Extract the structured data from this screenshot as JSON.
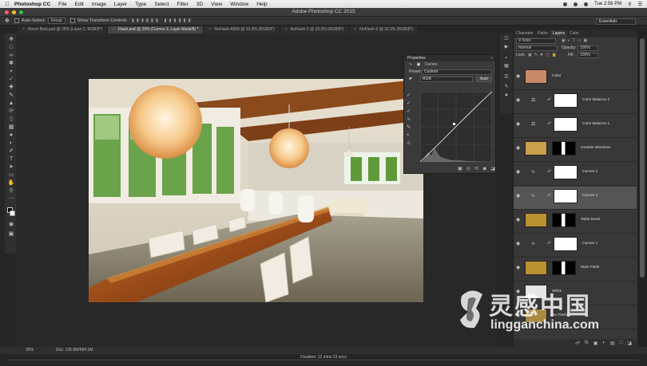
{
  "menubar": {
    "app": "Photoshop CC",
    "items": [
      "File",
      "Edit",
      "Image",
      "Layer",
      "Type",
      "Select",
      "Filter",
      "3D",
      "View",
      "Window",
      "Help"
    ],
    "clock": "Tue 2:56 PM"
  },
  "titlebar": {
    "title": "Adobe Photoshop CC 2015"
  },
  "options": {
    "auto_select_label": "Auto-Select:",
    "auto_select_value": "Group",
    "transform_label": "Show Transform Controls",
    "workspace": "Essentials"
  },
  "tabs": [
    {
      "label": "Room Best.psd @ 25% (Layer 2, RGB/8*)",
      "active": false
    },
    {
      "label": "Flash.psd @ 25% (Curves 3, Layer Mask/8) *",
      "active": true
    },
    {
      "label": "NoFlash.ARW @ 33.3% (RGB/8*)",
      "active": false
    },
    {
      "label": "NoFlash-2 @ 33.3% (RGB/8*)",
      "active": false
    },
    {
      "label": "NoFlash-3 @ 33.3% (RGB/8*)",
      "active": false
    }
  ],
  "properties": {
    "title": "Properties",
    "panel_name": "Curves",
    "preset_label": "Preset:",
    "preset_value": "Custom",
    "channel_value": "RGB",
    "auto_label": "Auto",
    "close_glyph": "»"
  },
  "layers_panel": {
    "tabs": [
      "Channels",
      "Paths",
      "Layers",
      "Color"
    ],
    "active_tab": "Layers",
    "filter_kind": "Kind",
    "blend_mode": "Normal",
    "opacity_label": "Opacity:",
    "opacity_value": "100%",
    "lock_label": "Lock:",
    "fill_label": "Fill:",
    "fill_value": "100%",
    "layers": [
      {
        "name": "Color",
        "thumb_color": "#c98a6a",
        "type": "pixel",
        "selected": false
      },
      {
        "name": "Color Balance 2",
        "thumb_color": "#ffffff",
        "type": "adjustment",
        "adj_icon": "balance",
        "selected": false
      },
      {
        "name": "Color Balance 1",
        "thumb_color": "#ffffff",
        "type": "adjustment",
        "adj_icon": "balance",
        "selected": false
      },
      {
        "name": "Outside Windows",
        "thumb_color": "#c8a14a",
        "type": "masked",
        "selected": false
      },
      {
        "name": "Curves 2",
        "thumb_color": "#ffffff",
        "type": "adjustment",
        "adj_icon": "curves",
        "selected": false
      },
      {
        "name": "Curves 3",
        "thumb_color": "#ffffff",
        "type": "adjustment",
        "adj_icon": "curves",
        "selected": true
      },
      {
        "name": "Table bevel",
        "thumb_color": "#b8922e",
        "type": "masked",
        "selected": false
      },
      {
        "name": "Curves 1",
        "thumb_color": "#ffffff",
        "type": "adjustment",
        "adj_icon": "curves",
        "selected": false
      },
      {
        "name": "Main Flash",
        "thumb_color": "#b8922e",
        "type": "masked",
        "selected": false
      },
      {
        "name": "White",
        "thumb_color": "#e6e6e6",
        "type": "pixel",
        "selected": false
      },
      {
        "name": "No Flash",
        "thumb_color": "#a98a40",
        "type": "pixel",
        "selected": false
      }
    ]
  },
  "status": {
    "zoom": "25%",
    "doc": "Doc: 135.6M/684.1M",
    "duration": "Duration: 12 mins 23 secs"
  },
  "watermark": {
    "zh": "灵感中国",
    "en": "lingganchina.com"
  }
}
